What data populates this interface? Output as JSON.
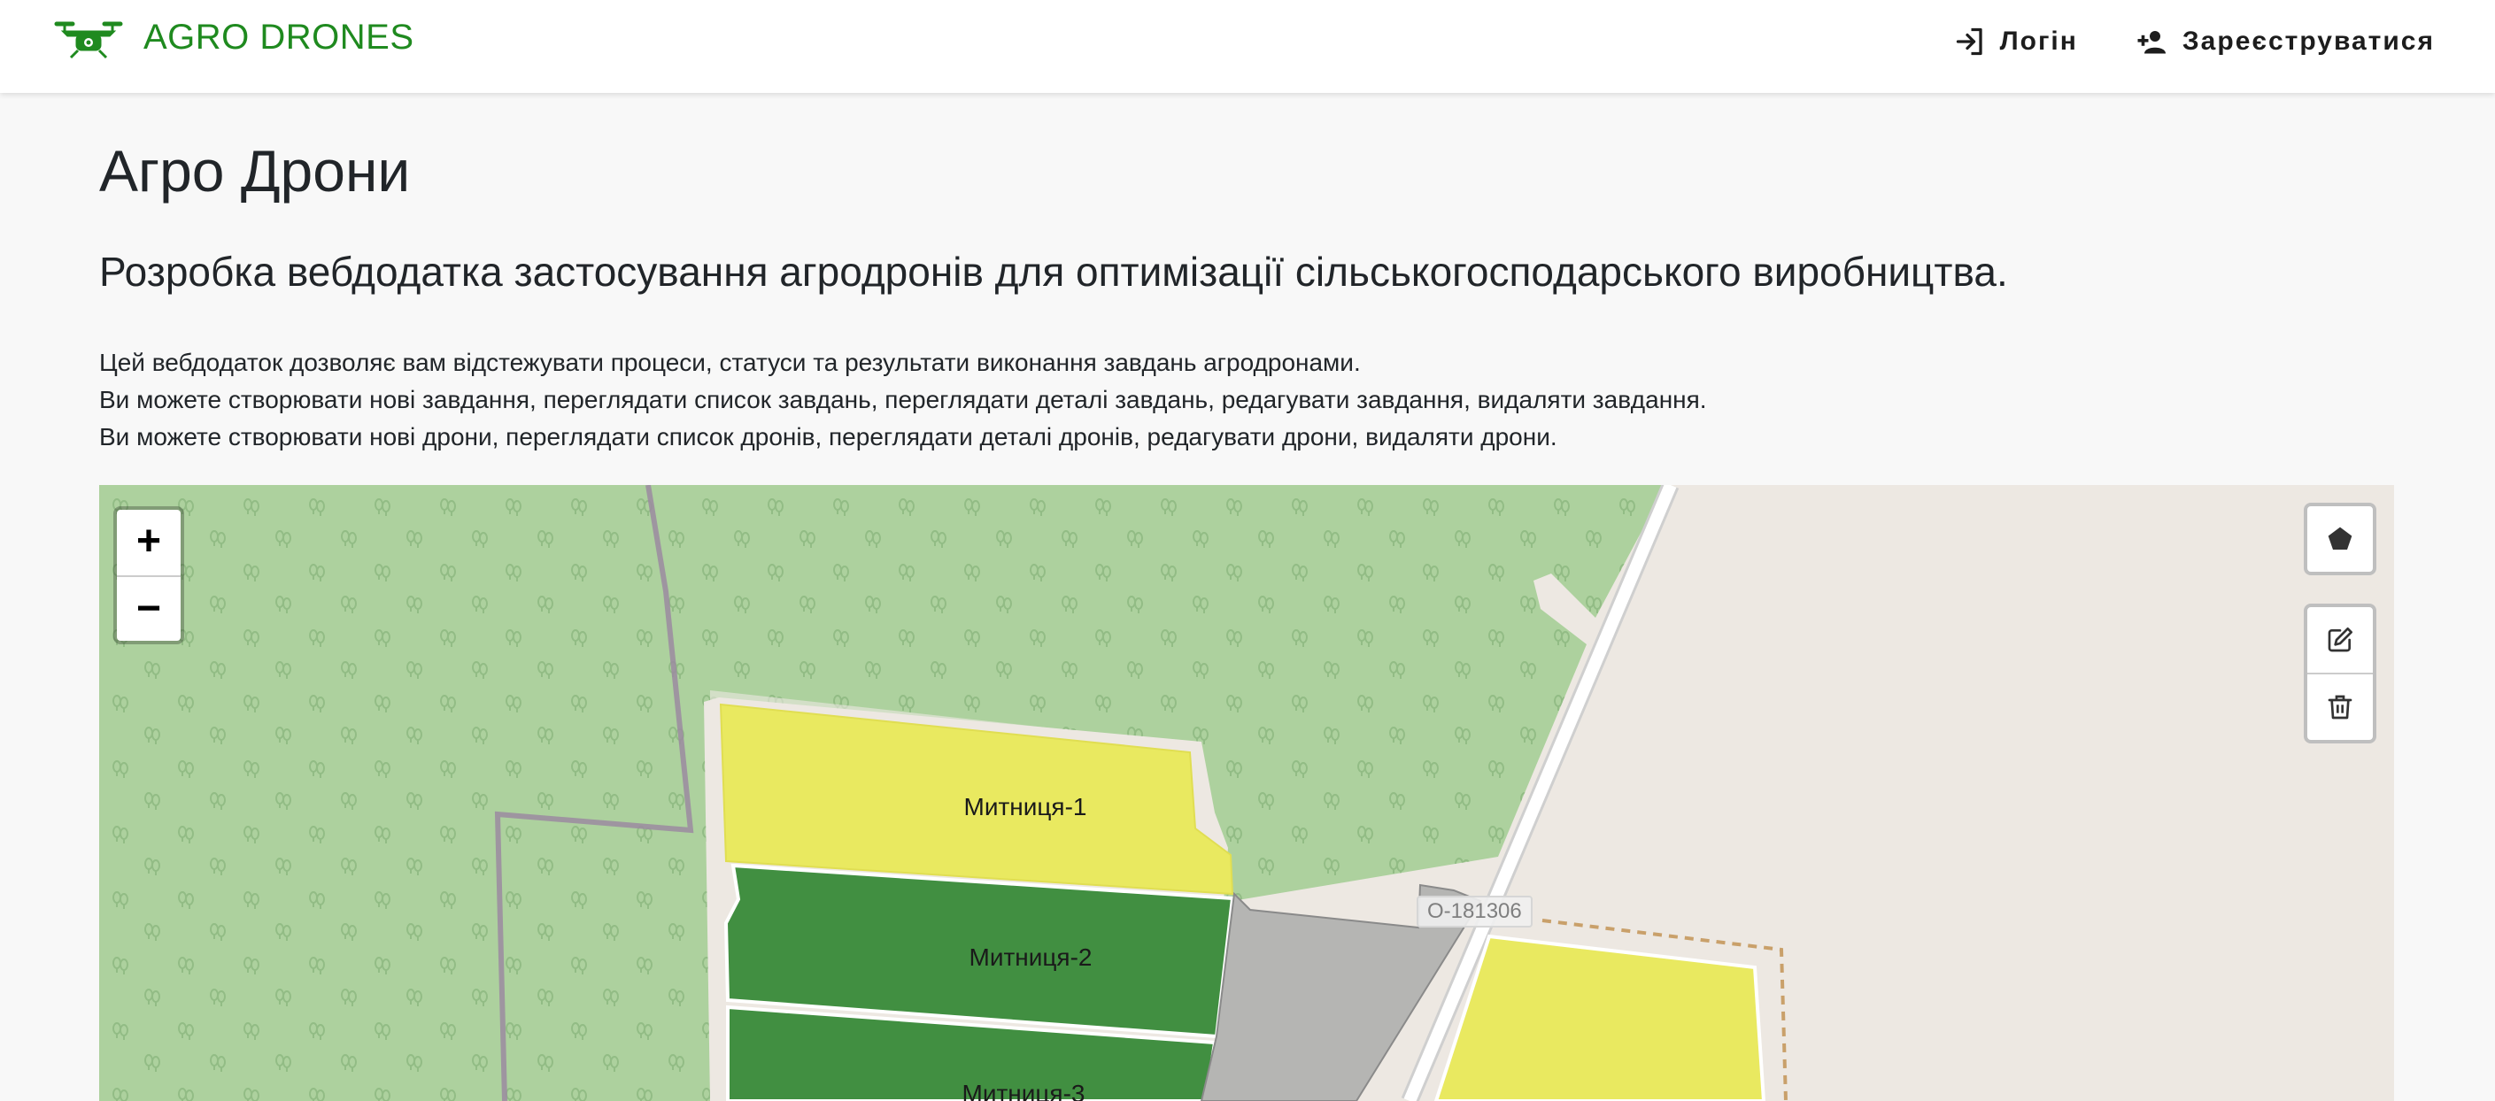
{
  "navbar": {
    "brand_text": "AGRO DRONES",
    "brand_color": "#1f8a1f",
    "login_label": "Логін",
    "register_label": "Зареєструватися"
  },
  "main": {
    "title": "Агро Дрони",
    "subtitle": "Розробка вебдодатка застосування агродронів для оптимізації сільськогосподарського виробництва.",
    "description": [
      "Цей вебдодаток дозволяє вам відстежувати процеси, статуси та результати виконання завдань агродронами.",
      "Ви можете створювати нові завдання, переглядати список завдань, переглядати деталі завдань, редагувати завдання, видаляти завдання.",
      "Ви можете створювати нові дрони, переглядати список дронів, переглядати деталі дронів, редагувати дрони, видаляти дрони."
    ]
  },
  "map": {
    "zoom_in": "+",
    "zoom_out": "−",
    "fields": [
      {
        "name": "Митниця-1",
        "color": "#e9e960"
      },
      {
        "name": "Митниця-2",
        "color": "#418f41"
      },
      {
        "name": "Митниця-3",
        "color": "#418f41"
      }
    ],
    "road_label": "O-181306",
    "colors": {
      "forest": "#add19e",
      "ground": "#ede8e2",
      "field_yellow": "#e9e960",
      "field_green": "#418f41",
      "field_gray": "#b5b5b3"
    },
    "icons": {
      "draw_polygon": "pentagon-icon",
      "edit": "edit-icon",
      "delete": "trash-icon"
    }
  }
}
